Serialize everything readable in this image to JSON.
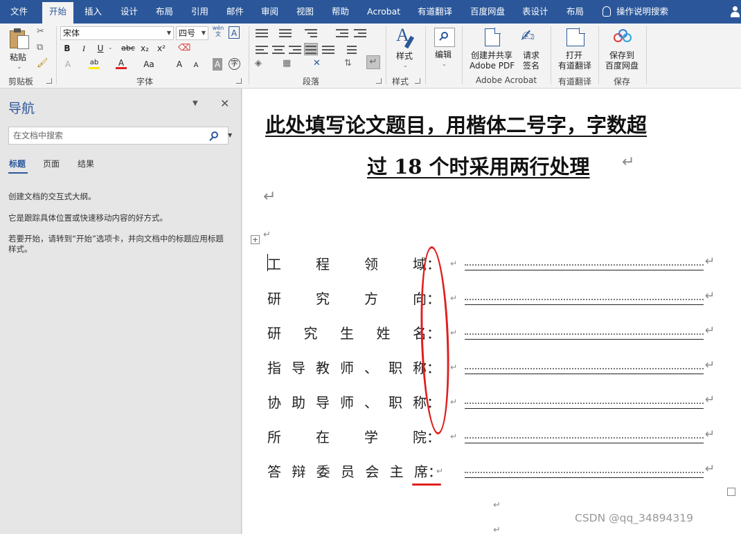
{
  "menu": {
    "tabs": [
      "文件",
      "开始",
      "插入",
      "设计",
      "布局",
      "引用",
      "邮件",
      "审阅",
      "视图",
      "帮助",
      "Acrobat",
      "有道翻译",
      "百度网盘",
      "表设计",
      "布局"
    ],
    "tell_me": "操作说明搜索"
  },
  "ribbon": {
    "clipboard": {
      "paste": "粘贴",
      "group": "剪贴板"
    },
    "font": {
      "name": "宋体",
      "size": "四号",
      "wen": "wén\n文",
      "group": "字体",
      "bold": "B",
      "italic": "I",
      "underline": "U",
      "strike": "abc",
      "sub": "x₂",
      "sup": "x²",
      "font_color": "A",
      "highlight": "ab",
      "case": "Aa",
      "grow": "A",
      "shrink": "A",
      "char_shade": "A",
      "enclose": "字"
    },
    "paragraph": {
      "group": "段落"
    },
    "styles": {
      "label": "样式",
      "group": "样式"
    },
    "editing": {
      "label": "编辑"
    },
    "acrobat": {
      "create_share": "创建并共享",
      "create_pdf": "Adobe PDF",
      "request": "请求",
      "sign": "签名",
      "group": "Adobe Acrobat"
    },
    "youdao": {
      "open": "打开",
      "translate": "有道翻译",
      "group": "有道翻译"
    },
    "baidu": {
      "save_to": "保存到",
      "netdisk": "百度网盘",
      "group": "保存"
    }
  },
  "nav": {
    "title": "导航",
    "search_placeholder": "在文档中搜索",
    "tabs": [
      "标题",
      "页面",
      "结果"
    ],
    "help": [
      "创建文档的交互式大纲。",
      "它是跟踪具体位置或快速移动内容的好方式。",
      "若要开始，请转到“开始”选项卡，并向文档中的标题应用标题样式。"
    ]
  },
  "document": {
    "title_line1": "此处填写论文题目，用楷体二号字，字数超",
    "title_line2": "过 18 个时采用两行处理",
    "para_mark": "↵",
    "rows": [
      {
        "chars": [
          "工",
          "程",
          "领",
          "域："
        ]
      },
      {
        "chars": [
          "研",
          "究",
          "方",
          "向："
        ]
      },
      {
        "chars": [
          "研",
          "究",
          "生",
          "姓",
          "名："
        ]
      },
      {
        "chars": [
          "指",
          "导",
          "教",
          "师",
          "、",
          "职",
          "称："
        ]
      },
      {
        "chars": [
          "协",
          "助",
          "导",
          "师",
          "、",
          "职",
          "称："
        ]
      },
      {
        "chars": [
          "所",
          "在",
          "学",
          "院："
        ]
      },
      {
        "chars": [
          "答",
          "辩",
          "委",
          "员",
          "会",
          "主",
          "席："
        ]
      }
    ],
    "annotation_color": "#e01e1e"
  },
  "watermark": "CSDN @qq_34894319",
  "colors": {
    "word_blue": "#2b579a"
  }
}
